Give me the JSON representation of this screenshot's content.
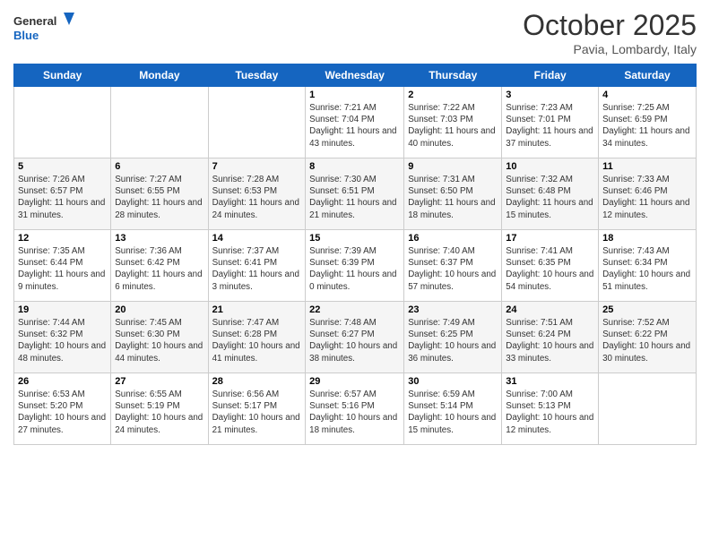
{
  "logo": {
    "general": "General",
    "blue": "Blue"
  },
  "title": "October 2025",
  "subtitle": "Pavia, Lombardy, Italy",
  "days_of_week": [
    "Sunday",
    "Monday",
    "Tuesday",
    "Wednesday",
    "Thursday",
    "Friday",
    "Saturday"
  ],
  "weeks": [
    [
      {
        "day": "",
        "info": ""
      },
      {
        "day": "",
        "info": ""
      },
      {
        "day": "",
        "info": ""
      },
      {
        "day": "1",
        "info": "Sunrise: 7:21 AM\nSunset: 7:04 PM\nDaylight: 11 hours and 43 minutes."
      },
      {
        "day": "2",
        "info": "Sunrise: 7:22 AM\nSunset: 7:03 PM\nDaylight: 11 hours and 40 minutes."
      },
      {
        "day": "3",
        "info": "Sunrise: 7:23 AM\nSunset: 7:01 PM\nDaylight: 11 hours and 37 minutes."
      },
      {
        "day": "4",
        "info": "Sunrise: 7:25 AM\nSunset: 6:59 PM\nDaylight: 11 hours and 34 minutes."
      }
    ],
    [
      {
        "day": "5",
        "info": "Sunrise: 7:26 AM\nSunset: 6:57 PM\nDaylight: 11 hours and 31 minutes."
      },
      {
        "day": "6",
        "info": "Sunrise: 7:27 AM\nSunset: 6:55 PM\nDaylight: 11 hours and 28 minutes."
      },
      {
        "day": "7",
        "info": "Sunrise: 7:28 AM\nSunset: 6:53 PM\nDaylight: 11 hours and 24 minutes."
      },
      {
        "day": "8",
        "info": "Sunrise: 7:30 AM\nSunset: 6:51 PM\nDaylight: 11 hours and 21 minutes."
      },
      {
        "day": "9",
        "info": "Sunrise: 7:31 AM\nSunset: 6:50 PM\nDaylight: 11 hours and 18 minutes."
      },
      {
        "day": "10",
        "info": "Sunrise: 7:32 AM\nSunset: 6:48 PM\nDaylight: 11 hours and 15 minutes."
      },
      {
        "day": "11",
        "info": "Sunrise: 7:33 AM\nSunset: 6:46 PM\nDaylight: 11 hours and 12 minutes."
      }
    ],
    [
      {
        "day": "12",
        "info": "Sunrise: 7:35 AM\nSunset: 6:44 PM\nDaylight: 11 hours and 9 minutes."
      },
      {
        "day": "13",
        "info": "Sunrise: 7:36 AM\nSunset: 6:42 PM\nDaylight: 11 hours and 6 minutes."
      },
      {
        "day": "14",
        "info": "Sunrise: 7:37 AM\nSunset: 6:41 PM\nDaylight: 11 hours and 3 minutes."
      },
      {
        "day": "15",
        "info": "Sunrise: 7:39 AM\nSunset: 6:39 PM\nDaylight: 11 hours and 0 minutes."
      },
      {
        "day": "16",
        "info": "Sunrise: 7:40 AM\nSunset: 6:37 PM\nDaylight: 10 hours and 57 minutes."
      },
      {
        "day": "17",
        "info": "Sunrise: 7:41 AM\nSunset: 6:35 PM\nDaylight: 10 hours and 54 minutes."
      },
      {
        "day": "18",
        "info": "Sunrise: 7:43 AM\nSunset: 6:34 PM\nDaylight: 10 hours and 51 minutes."
      }
    ],
    [
      {
        "day": "19",
        "info": "Sunrise: 7:44 AM\nSunset: 6:32 PM\nDaylight: 10 hours and 48 minutes."
      },
      {
        "day": "20",
        "info": "Sunrise: 7:45 AM\nSunset: 6:30 PM\nDaylight: 10 hours and 44 minutes."
      },
      {
        "day": "21",
        "info": "Sunrise: 7:47 AM\nSunset: 6:28 PM\nDaylight: 10 hours and 41 minutes."
      },
      {
        "day": "22",
        "info": "Sunrise: 7:48 AM\nSunset: 6:27 PM\nDaylight: 10 hours and 38 minutes."
      },
      {
        "day": "23",
        "info": "Sunrise: 7:49 AM\nSunset: 6:25 PM\nDaylight: 10 hours and 36 minutes."
      },
      {
        "day": "24",
        "info": "Sunrise: 7:51 AM\nSunset: 6:24 PM\nDaylight: 10 hours and 33 minutes."
      },
      {
        "day": "25",
        "info": "Sunrise: 7:52 AM\nSunset: 6:22 PM\nDaylight: 10 hours and 30 minutes."
      }
    ],
    [
      {
        "day": "26",
        "info": "Sunrise: 6:53 AM\nSunset: 5:20 PM\nDaylight: 10 hours and 27 minutes."
      },
      {
        "day": "27",
        "info": "Sunrise: 6:55 AM\nSunset: 5:19 PM\nDaylight: 10 hours and 24 minutes."
      },
      {
        "day": "28",
        "info": "Sunrise: 6:56 AM\nSunset: 5:17 PM\nDaylight: 10 hours and 21 minutes."
      },
      {
        "day": "29",
        "info": "Sunrise: 6:57 AM\nSunset: 5:16 PM\nDaylight: 10 hours and 18 minutes."
      },
      {
        "day": "30",
        "info": "Sunrise: 6:59 AM\nSunset: 5:14 PM\nDaylight: 10 hours and 15 minutes."
      },
      {
        "day": "31",
        "info": "Sunrise: 7:00 AM\nSunset: 5:13 PM\nDaylight: 10 hours and 12 minutes."
      },
      {
        "day": "",
        "info": ""
      }
    ]
  ]
}
